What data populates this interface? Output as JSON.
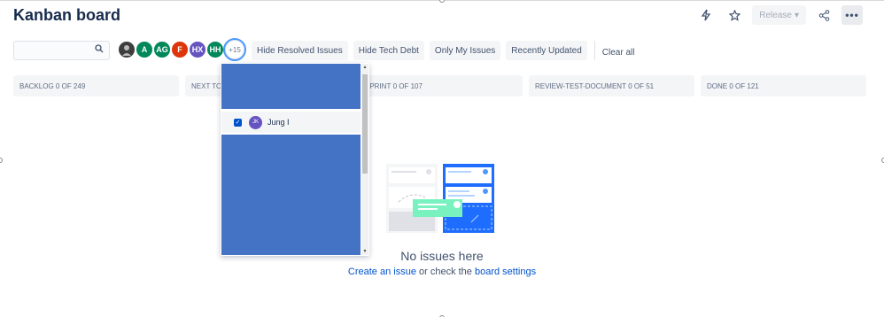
{
  "header": {
    "title": "Kanban board",
    "release_label": "Release"
  },
  "filters": {
    "avatars": [
      {
        "initials": "",
        "color": "#3d3d3d",
        "kind": "photo"
      },
      {
        "initials": "A",
        "color": "#00875a"
      },
      {
        "initials": "AG",
        "color": "#00875a"
      },
      {
        "initials": "F",
        "color": "#de350b"
      },
      {
        "initials": "HX",
        "color": "#6554c0"
      },
      {
        "initials": "HH",
        "color": "#00875a"
      }
    ],
    "more_count": "+15",
    "quick_filters": [
      "Hide Resolved Issues",
      "Hide Tech Debt",
      "Only My Issues",
      "Recently Updated"
    ],
    "clear_all": "Clear all"
  },
  "columns": [
    {
      "name": "BACKLOG",
      "count": "0 of 249"
    },
    {
      "name": "NEXT TO",
      "count": ""
    },
    {
      "name": "SPRINT",
      "count": "0 of 107"
    },
    {
      "name": "REVIEW-TEST-DOCUMENT",
      "count": "0 of 51"
    },
    {
      "name": "DONE",
      "count": "0 of 121"
    }
  ],
  "dropdown": {
    "selected_user_initials": "JK",
    "selected_user_name": "Jung I"
  },
  "empty_state": {
    "title": "No issues here",
    "create_link": "Create an issue",
    "middle_text": " or check the ",
    "settings_link": "board settings"
  }
}
